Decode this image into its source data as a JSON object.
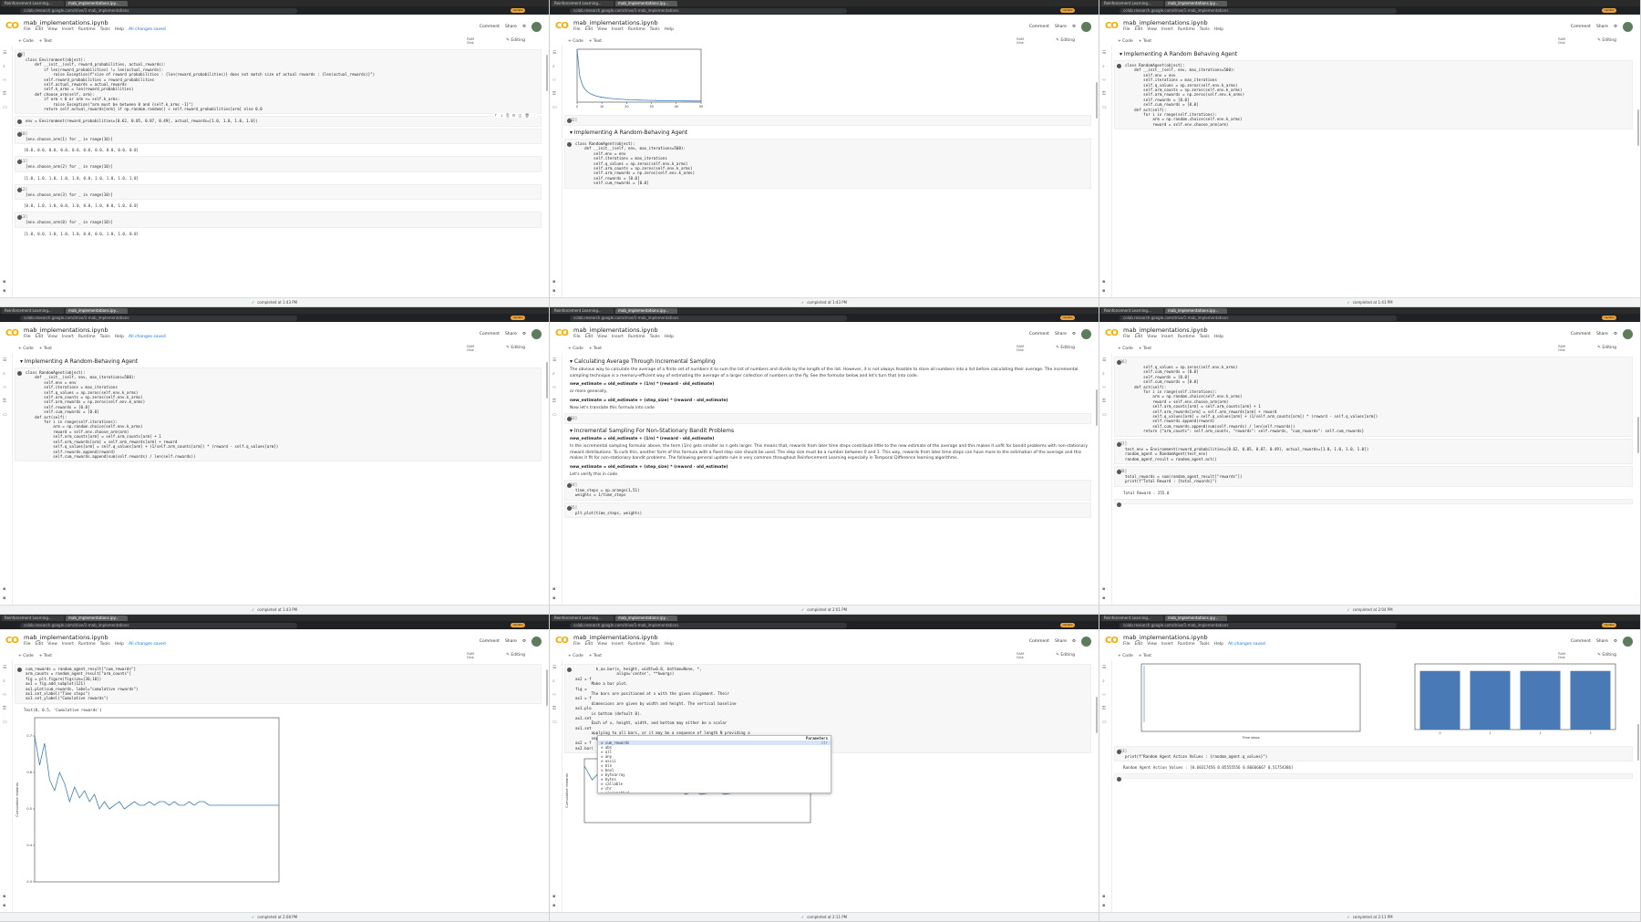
{
  "browser": {
    "tab_titles": [
      "Reinforcement Learning...",
      "mab_implementations.ipy..."
    ],
    "url": "colab.research.google.com/drive/1-mab_implementations"
  },
  "colab": {
    "logo": "CO",
    "notebook_title": "mab_implementations.ipynb",
    "menu": [
      "File",
      "Edit",
      "View",
      "Insert",
      "Runtime",
      "Tools",
      "Help"
    ],
    "saved_status": "All changes saved",
    "comment_label": "Comment",
    "share_label": "Share",
    "add_code": "+ Code",
    "add_text": "+ Text",
    "ram_label": "RAM",
    "disk_label": "Disk",
    "editing_label": "Editing",
    "update_label": "Update"
  },
  "panels": [
    {
      "status": "completed at 1:43 PM",
      "cells": [
        {
          "kind": "code",
          "prompt": "[9]",
          "lines": [
            "class Environment(object):",
            "",
            "    def __init__(self, reward_probabilities, actual_rewards):",
            "        if len(reward_probabilities) != len(actual_rewards):",
            "            raise Exception(f\"size of reward probabilities : {len(reward_probabilities)} does not match size of actual rewards : {len(actual_rewards)}\")",
            "",
            "        self.reward_probabilities = reward_probabilities",
            "        self.actual_rewards = actual_rewards",
            "        self.k_arms = len(reward_probabilities)",
            "",
            "    def choose_arm(self, arm):",
            "        if arm < 0 or arm >= self.k_arms:",
            "            raise Exception(\"arm must be between 0 and {self.k_arms -1}\")",
            "",
            "        return self.actual_rewards[arm] if np.random.random() < self.reward_probabilities[arm] else 0.0"
          ]
        },
        {
          "kind": "code",
          "prompt": "",
          "lines": [
            "env = Environment(reward_probabilities=[0.62, 0.05, 0.87, 0.49], actual_rewards=[1.0, 1.0, 1.0, 1.0])"
          ]
        },
        {
          "kind": "code",
          "prompt": "[10]",
          "lines": [
            "[env.choose_arm(1) for _ in range(10)]"
          ]
        },
        {
          "kind": "out",
          "lines": [
            "[0.0, 0.0, 0.0, 0.0, 0.0, 0.0, 0.0, 0.0, 0.0, 0.0]"
          ]
        },
        {
          "kind": "code",
          "prompt": "[11]",
          "lines": [
            "[env.choose_arm(2) for _ in range(10)]"
          ]
        },
        {
          "kind": "out",
          "lines": [
            "[1.0, 1.0, 1.0, 1.0, 1.0, 0.0, 1.0, 1.0, 1.0, 1.0]"
          ]
        },
        {
          "kind": "code",
          "prompt": "[12]",
          "lines": [
            "[env.choose_arm(3) for _ in range(10)]"
          ]
        },
        {
          "kind": "out",
          "lines": [
            "[0.0, 1.0, 1.0, 0.0, 1.0, 0.0, 1.0, 0.0, 1.0, 0.0]"
          ]
        },
        {
          "kind": "code",
          "prompt": "[13]",
          "lines": [
            "[env.choose_arm(0) for _ in range(10)]"
          ]
        },
        {
          "kind": "out",
          "lines": [
            "[1.0, 0.0, 1.0, 1.0, 1.0, 0.0, 0.0, 1.0, 1.0, 0.0]"
          ]
        }
      ]
    },
    {
      "status": "completed at 1:43 PM",
      "cells": [
        {
          "kind": "chart",
          "ref": "decay_small"
        },
        {
          "kind": "code",
          "prompt": "[32]",
          "lines": [
            ""
          ]
        },
        {
          "kind": "heading",
          "text": "Implementing A Random-Behaving Agent"
        },
        {
          "kind": "code",
          "prompt": "",
          "lines": [
            "class RandomAgent(object):",
            "",
            "    def __init__(self, env, max_iterations=500):",
            "        self.env = env",
            "        self.iterations = max_iterations",
            "",
            "        self.q_values = np.zeros(self.env.k_arms)",
            "        self.arm_counts = np.zeros(self.env.k_arms)",
            "        self.arm_rewards = np.zeros(self.env.k_arms)",
            "",
            "        self.rewards = [0.0]",
            "        self.cum_rewards = [0.0]"
          ]
        }
      ]
    },
    {
      "status": "completed at 1:43 PM",
      "cells": [
        {
          "kind": "heading",
          "text": "Implementing A Random Behaving Agent"
        },
        {
          "kind": "code",
          "prompt": "",
          "lines": [
            "class RandomAgent(object):",
            "",
            "    def __init__(self, env, max_iterations=500):",
            "        self.env = env",
            "        self.iterations = max_iterations",
            "",
            "        self.q_values = np.zeros(self.env.k_arms)",
            "        self.arm_counts = np.zeros(self.env.k_arms)",
            "        self.arm_rewards = np.zeros(self.env.k_arms)",
            "",
            "        self.rewards = [0.0]",
            "        self.cum_rewards = [0.0]",
            "",
            "    def act(self):",
            "        for i in range(self.iterations):",
            "            arm = np.random.choice(self.env.k_arms)",
            "            reward = self.env.choose_arm(arm)"
          ]
        }
      ]
    },
    {
      "status": "completed at 1:43 PM",
      "cells": [
        {
          "kind": "heading",
          "text": "Implementing A Random-Behaving Agent"
        },
        {
          "kind": "code",
          "prompt": "",
          "lines": [
            "class RandomAgent(object):",
            "",
            "    def __init__(self, env, max_iterations=500):",
            "        self.env = env",
            "        self.iterations = max_iterations",
            "",
            "        self.q_values = np.zeros(self.env.k_arms)",
            "        self.arm_counts = np.zeros(self.env.k_arms)",
            "        self.arm_rewards = np.zeros(self.env.k_arms)",
            "",
            "        self.rewards = [0.0]",
            "        self.cum_rewards = [0.0]",
            "",
            "    def act(self):",
            "        for i in range(self.iterations):",
            "            arm = np.random.choice(self.env.k_arms)",
            "            reward = self.env.choose_arm(arm)",
            "",
            "            self.arm_counts[arm] = self.arm_counts[arm] + 1",
            "            self.arm_rewards[arm] = self.arm_rewards[arm] + reward",
            "",
            "            self.q_values[arm] = self.q_values[arm] + (1/self.arm_counts[arm]) * (reward - self.q_values[arm])",
            "            self.rewards.append(reward)",
            "            self.cum_rewards.append(sum(self.rewards) / len(self.rewards))"
          ]
        }
      ]
    },
    {
      "status": "completed at 2:01 PM",
      "cells": [
        {
          "kind": "heading",
          "text": "Calculating Average Through Incremental Sampling"
        },
        {
          "kind": "para",
          "text": "The obvious way to calculate the average of a finite set of numbers it to sum the list of numbers and divide by the length of the list. However, it is not always feasible to store all numbers into a list before calculating their average. The incremental sampling technique is a memory-efficient way of estimating the average of a larger collection of numbers on the fly. See the formular below and let's turn that into code."
        },
        {
          "kind": "bold",
          "text": "new_estimate = old_estimate + (1/n) * (reward - old_estimate)"
        },
        {
          "kind": "para",
          "text": "or more generally,"
        },
        {
          "kind": "bold",
          "text": "new_estimate = old_estimate + (step_size) * (reward - old_estimate)"
        },
        {
          "kind": "para",
          "text": "Now let's translate this formula into code"
        },
        {
          "kind": "code",
          "prompt": "[33]",
          "lines": [
            ""
          ]
        },
        {
          "kind": "heading",
          "text": "Incremental Sampling For Non-Stationary Bandit Problems"
        },
        {
          "kind": "bold",
          "text": "new_estimate = old_estimate + (1/n) * (reward - old_estimate)"
        },
        {
          "kind": "para",
          "text": "In the incremental sampling formular above, the term (1/n) gets smaller as n gets larger. This means that, rewards from later time steps contribute little to the new estimate of the average and this makes it unfit for bandit problems with non-stationary reward distributions. To curb this, another form of this formula with a fixed step size should be used. The step size must be a number between 0 and 1. This way, rewards from later time steps can have more to the estimation of the average and this makes it fit for non-stationary bandit problems. The following general update rule is very common throughout Reinforcement Learning especially in Temporal Difference learning algorithms."
        },
        {
          "kind": "bold",
          "text": "new_estimate = old_estimate + (step_size) * (reward - old_estimate)"
        },
        {
          "kind": "para",
          "text": "Let's verify this in code."
        },
        {
          "kind": "code",
          "prompt": "[34]",
          "lines": [
            "time_steps = np.arange(1,51)",
            "weights = 1/time_steps"
          ]
        },
        {
          "kind": "code",
          "prompt": "[35]",
          "lines": [
            "plt.plot(time_steps, weights)"
          ]
        }
      ]
    },
    {
      "status": "completed at 2:04 PM",
      "cells": [
        {
          "kind": "code",
          "prompt": "[36]",
          "lines": [
            "        self.q_values = np.zeros(self.env.k_arms)",
            "        self.cum_rewards = [0.0]",
            "",
            "        self.rewards = [0.0]",
            "        self.cum_rewards = [0.0]",
            "",
            "    def act(self):",
            "        for i in range(self.iterations):",
            "            arm = np.random.choice(self.env.k_arms)",
            "            reward = self.env.choose_arm(arm)",
            "",
            "            self.arm_counts[arm] = self.arm_counts[arm] + 1",
            "            self.arm_rewards[arm] = self.arm_rewards[arm] + reward",
            "",
            "            self.q_values[arm] = self.q_values[arm] + (1/self.arm_counts[arm]) * (reward - self.q_values[arm])",
            "            self.rewards.append(reward)",
            "            self.cum_rewards.append(sum(self.rewards) / len(self.rewards))",
            "",
            "        return {\"arm_counts\": self.arm_counts, \"rewards\": self.rewards, \"cum_rewards\": self.cum_rewards}"
          ]
        },
        {
          "kind": "code",
          "prompt": "[37]",
          "lines": [
            "test_env = Environment(reward_probabilities=[0.62, 0.05, 0.87, 0.49], actual_rewards=[1.0, 1.0, 1.0, 1.0])",
            "random_agent = RandomAgent(test_env)",
            "random_agent_result = random_agent.act()"
          ]
        },
        {
          "kind": "code",
          "prompt": "[38]",
          "lines": [
            "total_rewards = sum(random_agent_result[\"rewards\"])",
            "print(f\"Total Reward : {total_rewards}\")"
          ]
        },
        {
          "kind": "out",
          "lines": [
            "Total Reward : 255.0"
          ]
        },
        {
          "kind": "code",
          "prompt": "",
          "lines": [
            ""
          ]
        }
      ]
    },
    {
      "status": "completed at 2:08 PM",
      "cells": [
        {
          "kind": "code",
          "prompt": "",
          "lines": [
            "cum_rewards = random_agent_result[\"cum_rewards\"]",
            "arm_counts = random_agent_result[\"arm_counts\"]",
            "",
            "fig = plt.figure(figsize=[30,10])",
            "",
            "ax1 = fig.add_subplot(121)",
            "ax1.plot(cum_rewards, label=\"cumulative rewards\")",
            "ax1.set_xlabel(\"Time steps\")",
            "ax1.set_ylabel(\"Cumulative rewards\")"
          ]
        },
        {
          "kind": "out",
          "lines": [
            "Text(0, 0.5, 'Cumulative rewards')"
          ]
        },
        {
          "kind": "chart",
          "ref": "cum_big"
        }
      ]
    },
    {
      "status": "completed at 2:11 PM",
      "cells": [
        {
          "kind": "code",
          "prompt": "",
          "lines": [
            "         k_ax.bar(x, height, width=0.8, bottom=None, *,",
            "                  align='center', **kwargs)",
            "ax2 = f",
            "       Make a bar plot.",
            "fig = ",
            "       The bars are positioned at x with the given alignment. Their",
            "ax1 = f",
            "       dimensions are given by width and height. The vertical baseline",
            "ax1.plo",
            "       is bottom (default 0).",
            "ax1.set",
            "       Each of x, height, width, and bottom may either be a scalar",
            "ax1.set",
            "       applying to all bars, or it may be a sequence of length N providing a",
            "       separate value for each bar.",
            "",
            "ax2 = f",
            "ax2.bar("
          ]
        },
        {
          "kind": "chart",
          "ref": "cum_small"
        }
      ],
      "popup": {
        "title": "Parameters",
        "items": [
          "cum_rewards",
          "abs",
          "all",
          "any",
          "ascii",
          "bin",
          "bool",
          "bytearray",
          "bytes",
          "callable",
          "chr",
          "classmethod",
          "compile",
          "complex",
          "copyright",
          "credits",
          "delattr",
          "deprecationWarning",
          "dict",
          "dir",
          "divmod",
          "display"
        ],
        "active": 0,
        "item_tag": "str"
      }
    },
    {
      "status": "completed at 2:11 PM",
      "cells": [
        {
          "kind": "chart",
          "ref": "bars"
        },
        {
          "kind": "code",
          "prompt": "[53]",
          "lines": [
            "print(f\"Random Agent Action Values : {random_agent.q_values}\")"
          ]
        },
        {
          "kind": "out",
          "lines": [
            "Random Agent Action Values : [0.60317456 0.05555556 0.86666667 0.51754386]"
          ]
        },
        {
          "kind": "code",
          "prompt": "",
          "lines": [
            ""
          ]
        }
      ]
    }
  ],
  "chart_data": [
    {
      "id": "decay_small",
      "type": "line",
      "title": "",
      "xlabel": "",
      "ylabel": "",
      "x_ticks": [
        0,
        10,
        20,
        30,
        40,
        50
      ],
      "xlim": [
        0,
        50
      ],
      "ylim": [
        0,
        1.0
      ],
      "series": [
        {
          "values": [
            1.0,
            0.5,
            0.333,
            0.25,
            0.2,
            0.167,
            0.143,
            0.125,
            0.111,
            0.1,
            0.091,
            0.083,
            0.077,
            0.071,
            0.067,
            0.0625,
            0.059,
            0.056,
            0.053,
            0.05,
            0.048,
            0.045,
            0.043,
            0.042,
            0.04,
            0.038,
            0.037,
            0.036,
            0.034,
            0.033,
            0.032,
            0.031,
            0.03,
            0.029,
            0.029,
            0.028,
            0.027,
            0.026,
            0.026,
            0.025,
            0.024,
            0.024,
            0.023,
            0.023,
            0.022,
            0.022,
            0.021,
            0.021,
            0.02,
            0.02
          ]
        }
      ]
    },
    {
      "id": "cum_big",
      "type": "line",
      "title": "",
      "xlabel": "",
      "ylabel": "Cumulative rewards",
      "y_ticks": [
        0.3,
        0.4,
        0.5,
        0.6,
        0.7
      ],
      "xlim": [
        0,
        500
      ],
      "ylim": [
        0.3,
        0.75
      ],
      "series": [
        {
          "values": [
            0.7,
            0.62,
            0.68,
            0.58,
            0.55,
            0.6,
            0.57,
            0.52,
            0.56,
            0.53,
            0.55,
            0.52,
            0.54,
            0.5,
            0.52,
            0.5,
            0.51,
            0.52,
            0.5,
            0.51,
            0.52,
            0.51,
            0.51,
            0.52,
            0.51,
            0.52,
            0.52,
            0.51,
            0.52,
            0.51,
            0.51,
            0.52,
            0.51,
            0.52,
            0.52,
            0.51,
            0.51,
            0.51,
            0.51,
            0.51,
            0.51,
            0.51,
            0.51,
            0.51,
            0.51,
            0.51,
            0.51,
            0.51,
            0.51,
            0.51
          ]
        }
      ]
    },
    {
      "id": "cum_small",
      "type": "line",
      "title": "",
      "xlabel": "",
      "ylabel": "Cumulative rewards",
      "xlim": [
        0,
        500
      ],
      "ylim": [
        0.3,
        0.75
      ],
      "series": [
        {
          "values": [
            0.7,
            0.6,
            0.66,
            0.57,
            0.55,
            0.59,
            0.56,
            0.52,
            0.55,
            0.53,
            0.54,
            0.52,
            0.53,
            0.5,
            0.52,
            0.5,
            0.51,
            0.52,
            0.5,
            0.51,
            0.51,
            0.51,
            0.51,
            0.51,
            0.51,
            0.51,
            0.51,
            0.51,
            0.51,
            0.51
          ]
        }
      ]
    },
    {
      "id": "bars",
      "type": "bar",
      "title": "",
      "xlabel": "Time steps",
      "ylabel": "",
      "categories": [
        "0",
        "1",
        "2",
        "3"
      ],
      "values": [
        125,
        125,
        125,
        125
      ],
      "ylim": [
        0,
        140
      ]
    }
  ]
}
